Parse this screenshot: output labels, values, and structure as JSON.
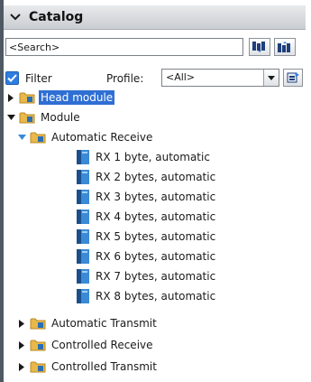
{
  "panel": {
    "title": "Catalog"
  },
  "search": {
    "placeholder": "<Search>"
  },
  "filter": {
    "checkbox_label": "Filter",
    "checked": true,
    "profile_label": "Profile:",
    "profile_value": "<All>"
  },
  "tree": {
    "head_module": "Head module",
    "module": "Module",
    "automatic_receive": "Automatic Receive",
    "rx_items": [
      "RX 1 byte, automatic",
      "RX 2 bytes, automatic",
      "RX 3 bytes, automatic",
      "RX 4 bytes, automatic",
      "RX 5 bytes, automatic",
      "RX 6 bytes, automatic",
      "RX 7 bytes, automatic",
      "RX 8 bytes, automatic"
    ],
    "automatic_transmit": "Automatic Transmit",
    "controlled_receive": "Controlled Receive",
    "controlled_transmit": "Controlled Transmit"
  },
  "colors": {
    "selection": "#2f6fd4",
    "folder": "#e8b84a",
    "module_icon": "#2a6fb5"
  }
}
